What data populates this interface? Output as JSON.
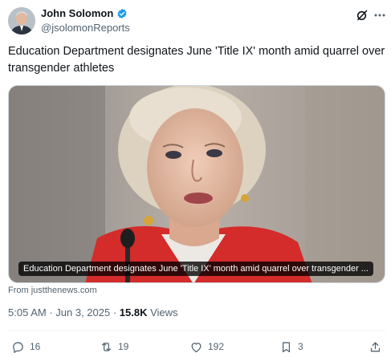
{
  "author": {
    "name": "John Solomon",
    "handle": "@jsolomonReports"
  },
  "tweet": {
    "text": "Education Department designates June 'Title IX' month amid quarrel over transgender athletes"
  },
  "card": {
    "caption": "Education Department designates June 'Title IX' month amid quarrel over transgender ...",
    "source": "From justthenews.com"
  },
  "meta": {
    "time": "5:05 AM",
    "separator1": " · ",
    "date": "Jun 3, 2025",
    "separator2": " · ",
    "views_count": "15.8K",
    "views_label": " Views"
  },
  "actions": {
    "replies": "16",
    "reposts": "19",
    "likes": "192",
    "bookmarks": "3"
  },
  "colors": {
    "verified": "#1d9bf0",
    "text": "#0f1419",
    "muted": "#536471"
  },
  "icons": [
    "verified-badge-icon",
    "grok-icon",
    "more-icon",
    "reply-icon",
    "repost-icon",
    "like-icon",
    "bookmark-icon",
    "share-icon"
  ]
}
